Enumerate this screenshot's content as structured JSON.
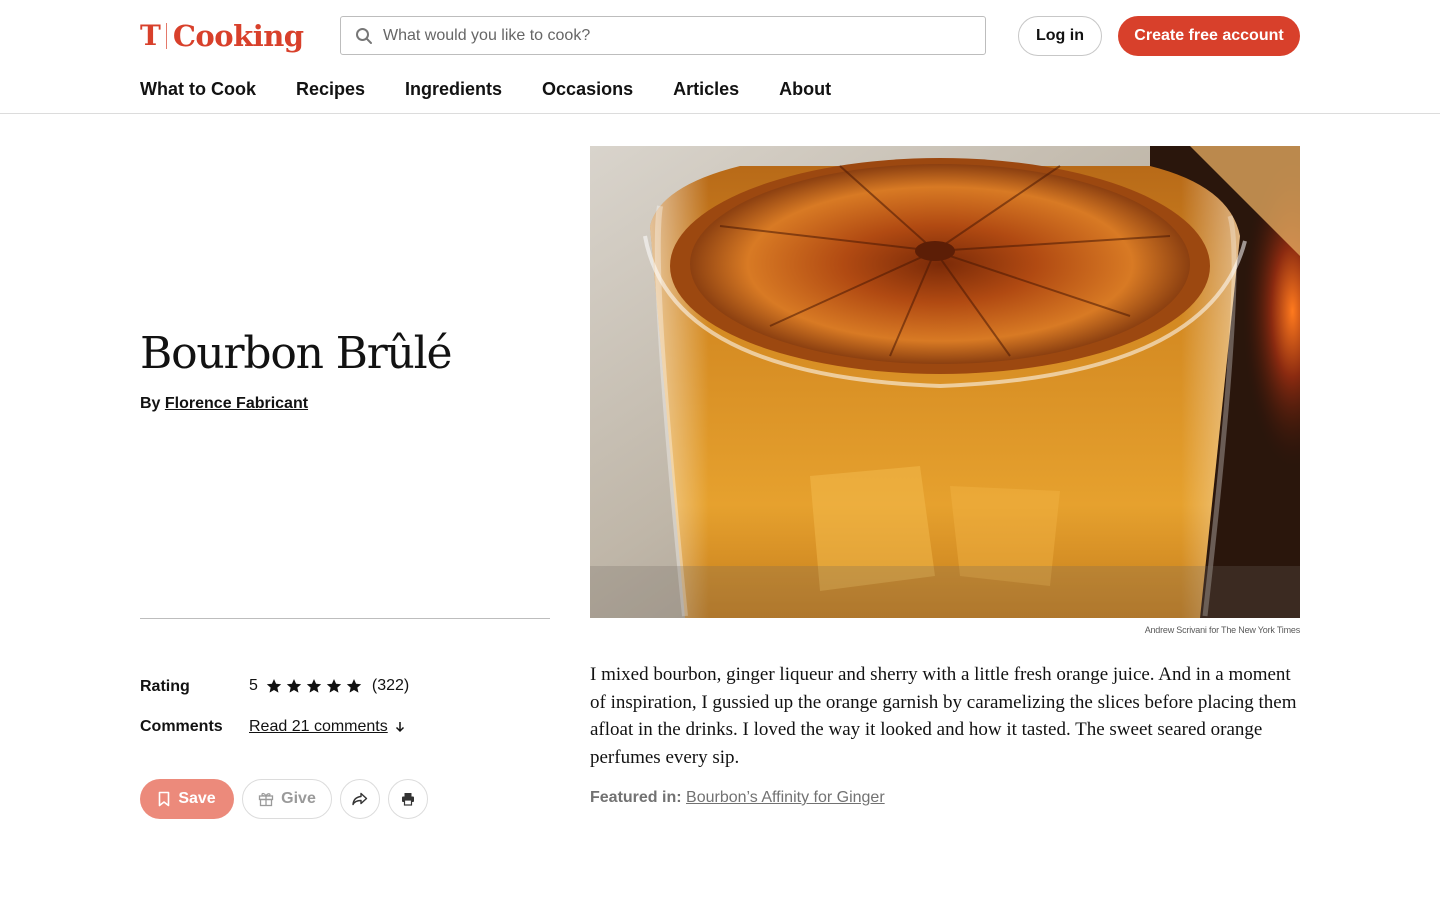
{
  "header": {
    "logo_mark": "T",
    "logo_word": "Cooking",
    "search_placeholder": "What would you like to cook?",
    "login_label": "Log in",
    "signup_label": "Create free account",
    "accent_color": "#d8402b"
  },
  "nav": {
    "items": [
      {
        "label": "What to Cook"
      },
      {
        "label": "Recipes"
      },
      {
        "label": "Ingredients"
      },
      {
        "label": "Occasions"
      },
      {
        "label": "Articles"
      },
      {
        "label": "About"
      }
    ]
  },
  "recipe": {
    "title": "Bourbon Brûlé",
    "byline_prefix": "By",
    "author": "Florence Fabricant",
    "rating_label": "Rating",
    "rating_value": "5",
    "rating_stars": 5,
    "rating_count": "(322)",
    "comments_label": "Comments",
    "comments_link": "Read 21 comments",
    "actions": {
      "save": "Save",
      "give": "Give"
    },
    "photo_credit": "Andrew Scrivani for The New York Times",
    "description": "I mixed bourbon, ginger liqueur and sherry with a little fresh orange juice. And in a moment of inspiration, I gussied up the orange garnish by caramelizing the slices before placing them afloat in the drinks. I loved the way it looked and how it tasted. The sweet seared orange perfumes every sip.",
    "featured_label": "Featured in:",
    "featured_link": "Bourbon’s Affinity for Ginger"
  },
  "icons": [
    "search-icon",
    "star-icon",
    "down-arrow-icon",
    "bookmark-icon",
    "gift-icon",
    "share-icon",
    "print-icon"
  ]
}
